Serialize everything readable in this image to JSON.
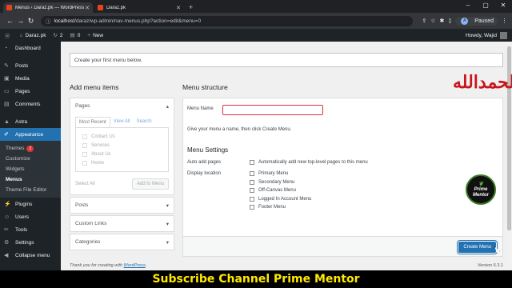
{
  "browser": {
    "tabs": [
      {
        "title": "Menus ‹ Daraz.pk — WordPress",
        "active": true
      },
      {
        "title": "Daraz.pk",
        "active": false
      }
    ],
    "url_host": "localhost",
    "url_path": "/daraz/wp-admin/nav-menus.php?action=edit&menu=0",
    "profile_initial": "A",
    "profile_status": "Paused"
  },
  "adminbar": {
    "site": "Daraz.pk",
    "updates": "2",
    "comments": "0",
    "new": "New",
    "howdy": "Howdy, Wajid"
  },
  "sidebar": {
    "items": [
      {
        "label": "Dashboard",
        "icon": "dashboard-icon"
      },
      {
        "label": "Posts",
        "icon": "pin-icon"
      },
      {
        "label": "Media",
        "icon": "media-icon"
      },
      {
        "label": "Pages",
        "icon": "page-icon"
      },
      {
        "label": "Comments",
        "icon": "comment-icon"
      },
      {
        "label": "Astra",
        "icon": "astra-icon"
      },
      {
        "label": "Appearance",
        "icon": "brush-icon"
      }
    ],
    "submenu": [
      {
        "label": "Themes",
        "badge": "2"
      },
      {
        "label": "Customize"
      },
      {
        "label": "Widgets"
      },
      {
        "label": "Menus"
      },
      {
        "label": "Theme File Editor"
      }
    ],
    "bottom": [
      {
        "label": "Plugins",
        "icon": "plugin-icon"
      },
      {
        "label": "Users",
        "icon": "users-icon"
      },
      {
        "label": "Tools",
        "icon": "tools-icon"
      },
      {
        "label": "Settings",
        "icon": "settings-icon"
      },
      {
        "label": "Collapse menu",
        "icon": "collapse-icon"
      }
    ]
  },
  "notice": "Create your first menu below.",
  "add_items": {
    "title": "Add menu items",
    "pages_title": "Pages",
    "tabs": [
      "Most Recent",
      "View All",
      "Search"
    ],
    "pages": [
      "Contact Us",
      "Services",
      "About Us",
      "Home"
    ],
    "select_all": "Select All",
    "add_button": "Add to Menu",
    "sections": [
      "Posts",
      "Custom Links",
      "Categories"
    ]
  },
  "structure": {
    "title": "Menu structure",
    "menu_name_label": "Menu Name",
    "menu_name_value": "",
    "hint": "Give your menu a name, then click Create Menu.",
    "settings_title": "Menu Settings",
    "auto_add_label": "Auto add pages",
    "auto_add_option": "Automatically add new top-level pages to this menu",
    "display_label": "Display location",
    "locations": [
      "Primary Menu",
      "Secondary Menu",
      "Off-Canvas Menu",
      "Logged In Account Menu",
      "Footer Menu"
    ],
    "create_button": "Create Menu"
  },
  "footer": {
    "thanks": "Thank you for creating with",
    "link": "WordPress",
    "suffix": ".",
    "version": "Version 6.3.1"
  },
  "overlay": {
    "arabic": "الحمدالله",
    "logo_line1": "Prime",
    "logo_line2": "Mentor",
    "banner": "Subscribe Channel Prime Mentor"
  },
  "colors": {
    "accent": "#2271b1",
    "admin_dark": "#1d2327",
    "error_border": "#d63638",
    "banner_text": "#ffea00"
  }
}
